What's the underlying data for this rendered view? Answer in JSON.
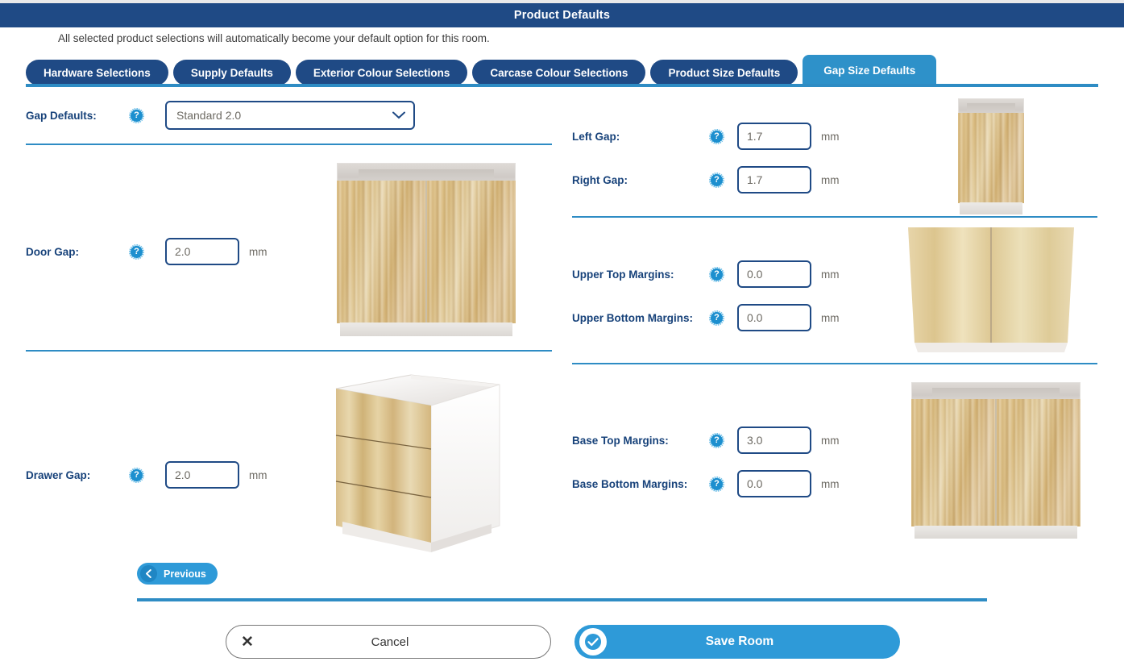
{
  "header": {
    "title": "Product Defaults"
  },
  "subtitle": "All selected product selections will automatically become your default option for this room.",
  "tabs": [
    {
      "label": "Hardware Selections",
      "active": false
    },
    {
      "label": "Supply Defaults",
      "active": false
    },
    {
      "label": "Exterior Colour Selections",
      "active": false
    },
    {
      "label": "Carcase Colour Selections",
      "active": false
    },
    {
      "label": "Product Size Defaults",
      "active": false
    },
    {
      "label": "Gap Size Defaults",
      "active": true
    }
  ],
  "left_panel": {
    "gap_defaults": {
      "label": "Gap Defaults:",
      "help_icon": "question-mark-icon",
      "selected": "Standard 2.0",
      "options": [
        "Standard 2.0"
      ],
      "chevron": "chevron-down-icon"
    },
    "door_gap": {
      "label": "Door Gap:",
      "help_icon": "question-mark-icon",
      "value": "2.0",
      "unit": "mm",
      "image": "base-cabinet-two-door-front"
    },
    "drawer_gap": {
      "label": "Drawer Gap:",
      "help_icon": "question-mark-icon",
      "value": "2.0",
      "unit": "mm",
      "image": "base-cabinet-three-drawer-angled"
    }
  },
  "right_panel": {
    "left_gap": {
      "label": "Left Gap:",
      "help_icon": "question-mark-icon",
      "value": "1.7",
      "unit": "mm"
    },
    "right_gap": {
      "label": "Right Gap:",
      "help_icon": "question-mark-icon",
      "value": "1.7",
      "unit": "mm",
      "image": "tall-narrow-cabinet-front"
    },
    "upper_top_margins": {
      "label": "Upper Top Margins:",
      "help_icon": "question-mark-icon",
      "value": "0.0",
      "unit": "mm"
    },
    "upper_bottom_margins": {
      "label": "Upper Bottom Margins:",
      "help_icon": "question-mark-icon",
      "value": "0.0",
      "unit": "mm",
      "image": "upper-wall-cabinet-two-door"
    },
    "base_top_margins": {
      "label": "Base Top Margins:",
      "help_icon": "question-mark-icon",
      "value": "3.0",
      "unit": "mm"
    },
    "base_bottom_margins": {
      "label": "Base Bottom Margins:",
      "help_icon": "question-mark-icon",
      "value": "0.0",
      "unit": "mm",
      "image": "base-cabinet-two-door-front"
    }
  },
  "footer": {
    "previous_label": "Previous",
    "previous_icon": "chevron-left-icon",
    "cancel_label": "Cancel",
    "cancel_icon": "close-x-icon",
    "save_label": "Save Room",
    "save_icon": "check-circle-icon"
  },
  "colors": {
    "header_navy": "#1f4a85",
    "accent_blue": "#2e9ad8",
    "divider_blue": "#2e8cc4",
    "label_navy": "#17427a"
  }
}
